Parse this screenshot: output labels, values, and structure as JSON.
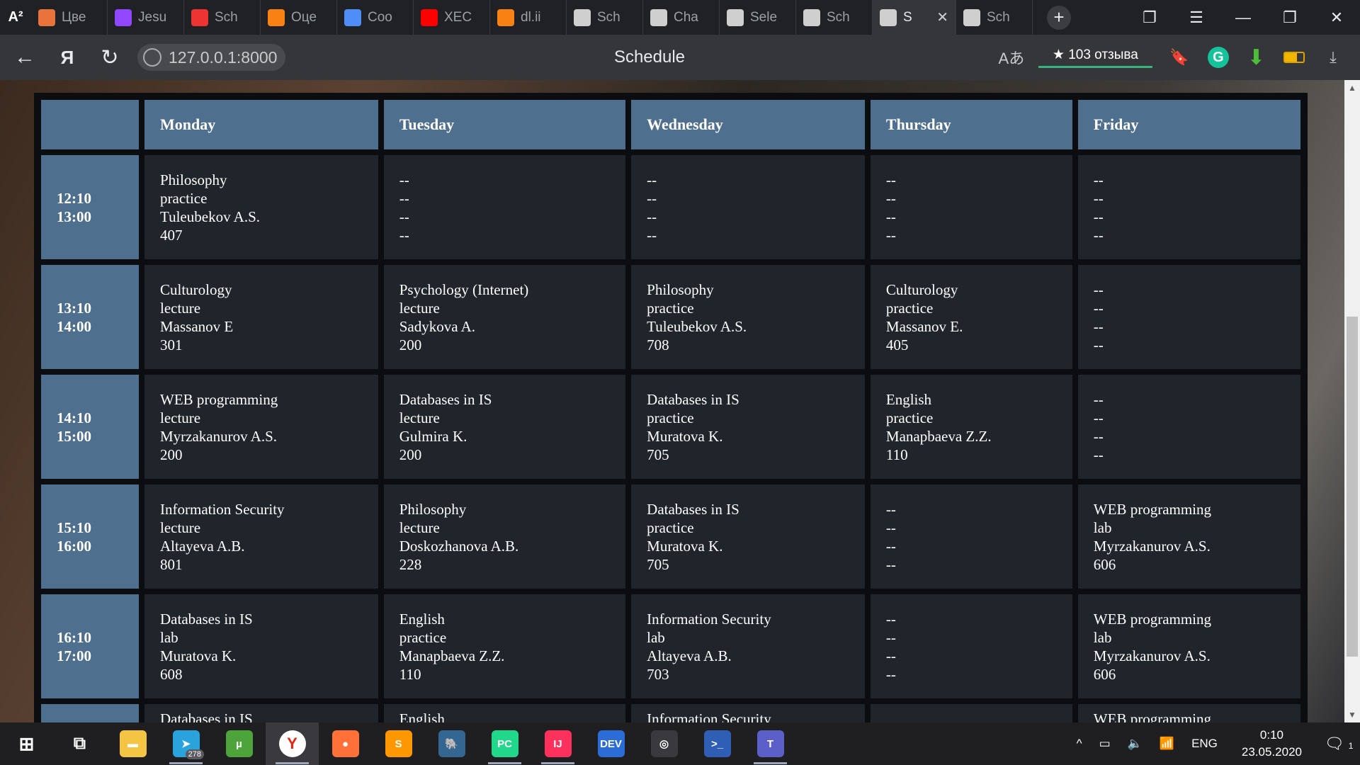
{
  "browser": {
    "logo": "A²",
    "tabs": [
      {
        "label": "Цве",
        "icon": "shopping-bag-icon",
        "color": "#e8743b"
      },
      {
        "label": "Jesu",
        "icon": "twitch-icon",
        "color": "#9146ff"
      },
      {
        "label": "Sch",
        "icon": "schedule-icon",
        "color": "#e33"
      },
      {
        "label": "Оце",
        "icon": "moodle-icon",
        "color": "#f98012"
      },
      {
        "label": "Coo",
        "icon": "chat-icon",
        "color": "#4f8ef7"
      },
      {
        "label": "XEC",
        "icon": "youtube-icon",
        "color": "#ff0000"
      },
      {
        "label": "dl.ii",
        "icon": "moodle-icon",
        "color": "#f98012"
      },
      {
        "label": "Sch",
        "icon": "calendar-icon",
        "color": "#cfcfcf"
      },
      {
        "label": "Cha",
        "icon": "document-icon",
        "color": "#cfcfcf"
      },
      {
        "label": "Sele",
        "icon": "document-icon",
        "color": "#cfcfcf"
      },
      {
        "label": "Sch",
        "icon": "calendar-icon",
        "color": "#cfcfcf"
      },
      {
        "label": "S",
        "icon": "calendar-icon",
        "color": "#cfcfcf",
        "active": true
      },
      {
        "label": "Sch",
        "icon": "calendar-icon",
        "color": "#cfcfcf"
      }
    ],
    "url": "127.0.0.1:8000",
    "page_title": "Schedule",
    "reviews": "★ 103 отзыва"
  },
  "schedule": {
    "headers": [
      "",
      "Monday",
      "Tuesday",
      "Wednesday",
      "Thursday",
      "Friday"
    ],
    "rows": [
      {
        "time": [
          "12:10",
          "13:00"
        ],
        "cells": [
          [
            "Philosophy",
            "practice",
            "Tuleubekov A.S.",
            "407"
          ],
          [
            "--",
            "--",
            "--",
            "--"
          ],
          [
            "--",
            "--",
            "--",
            "--"
          ],
          [
            "--",
            "--",
            "--",
            "--"
          ],
          [
            "--",
            "--",
            "--",
            "--"
          ]
        ]
      },
      {
        "time": [
          "13:10",
          "14:00"
        ],
        "cells": [
          [
            "Culturology",
            "lecture",
            "Massanov E",
            "301"
          ],
          [
            "Psychology (Internet)",
            "lecture",
            "Sadykova A.",
            "200"
          ],
          [
            "Philosophy",
            "practice",
            "Tuleubekov A.S.",
            "708"
          ],
          [
            "Culturology",
            "practice",
            "Massanov E.",
            "405"
          ],
          [
            "--",
            "--",
            "--",
            "--"
          ]
        ]
      },
      {
        "time": [
          "14:10",
          "15:00"
        ],
        "cells": [
          [
            "WEB programming",
            "lecture",
            "Myrzakanurov A.S.",
            "200"
          ],
          [
            "Databases in IS",
            "lecture",
            "Gulmira K.",
            "200"
          ],
          [
            "Databases in IS",
            "practice",
            "Muratova K.",
            "705"
          ],
          [
            "English",
            "practice",
            "Manapbaeva Z.Z.",
            "110"
          ],
          [
            "--",
            "--",
            "--",
            "--"
          ]
        ]
      },
      {
        "time": [
          "15:10",
          "16:00"
        ],
        "cells": [
          [
            "Information Security",
            "lecture",
            "Altayeva A.B.",
            "801"
          ],
          [
            "Philosophy",
            "lecture",
            "Doskozhanova A.B.",
            "228"
          ],
          [
            "Databases in IS",
            "practice",
            "Muratova K.",
            "705"
          ],
          [
            "--",
            "--",
            "--",
            "--"
          ],
          [
            "WEB programming",
            "lab",
            "Myrzakanurov A.S.",
            "606"
          ]
        ]
      },
      {
        "time": [
          "16:10",
          "17:00"
        ],
        "cells": [
          [
            "Databases in IS",
            "lab",
            "Muratova K.",
            "608"
          ],
          [
            "English",
            "practice",
            "Manapbaeva Z.Z.",
            "110"
          ],
          [
            "Information Security",
            "lab",
            "Altayeva A.B.",
            "703"
          ],
          [
            "--",
            "--",
            "--",
            "--"
          ],
          [
            "WEB programming",
            "lab",
            "Myrzakanurov A.S.",
            "606"
          ]
        ]
      }
    ],
    "partial_row": {
      "cells": [
        "Databases in IS",
        "English",
        "Information Security",
        "",
        "WEB programming"
      ]
    }
  },
  "taskbar": {
    "apps": [
      {
        "name": "task-view",
        "glyph": "⧉",
        "color": "#1f1f22"
      },
      {
        "name": "file-explorer",
        "glyph": "▬",
        "color": "#f4c542"
      },
      {
        "name": "telegram",
        "glyph": "➤",
        "color": "#2aa3dc",
        "badge": "278",
        "running": true
      },
      {
        "name": "utorrent",
        "glyph": "µ",
        "color": "#4ca43a"
      },
      {
        "name": "yandex-browser",
        "glyph": "Y",
        "color": "#ffffff",
        "running": true,
        "focused": true
      },
      {
        "name": "firefox",
        "glyph": "●",
        "color": "#ff7139"
      },
      {
        "name": "sublime-text",
        "glyph": "S",
        "color": "#ff9800"
      },
      {
        "name": "postgresql",
        "glyph": "🐘",
        "color": "#336791"
      },
      {
        "name": "pycharm",
        "glyph": "PC",
        "color": "#21d789",
        "running": true
      },
      {
        "name": "intellij",
        "glyph": "IJ",
        "color": "#fe315d",
        "running": true
      },
      {
        "name": "devcpp",
        "glyph": "DEV",
        "color": "#2b6cd6"
      },
      {
        "name": "obs",
        "glyph": "◎",
        "color": "#3a3a3e"
      },
      {
        "name": "powershell",
        "glyph": ">_",
        "color": "#2f5fb5"
      },
      {
        "name": "teams",
        "glyph": "T",
        "color": "#5b5fc7",
        "running": true
      }
    ],
    "lang": "ENG",
    "time": "0:10",
    "date": "23.05.2020",
    "notifications": "1"
  }
}
